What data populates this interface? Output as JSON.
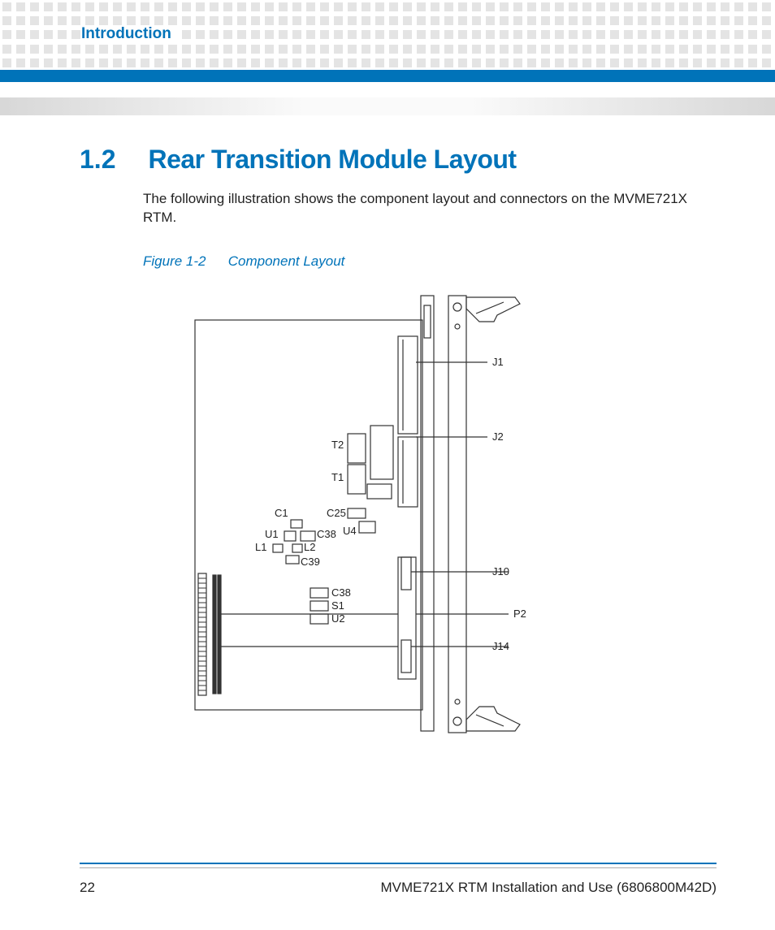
{
  "header": {
    "chapter_label": "Introduction"
  },
  "section": {
    "number": "1.2",
    "title": "Rear Transition Module Layout",
    "body": "The following illustration shows the component layout and connectors on the MVME721X RTM."
  },
  "figure": {
    "number": "Figure 1-2",
    "title": "Component Layout",
    "labels": {
      "J1": "J1",
      "J2": "J2",
      "J10": "J10",
      "J14": "J14",
      "P2": "P2",
      "T1": "T1",
      "T2": "T2",
      "C1": "C1",
      "C25": "C25",
      "C38a": "C38",
      "C38b": "C38",
      "C39": "C39",
      "U1": "U1",
      "U2": "U2",
      "U4": "U4",
      "L1": "L1",
      "L2": "L2",
      "S1": "S1"
    }
  },
  "footer": {
    "page_number": "22",
    "doc_title": "MVME721X RTM Installation and Use (6806800M42D)"
  }
}
